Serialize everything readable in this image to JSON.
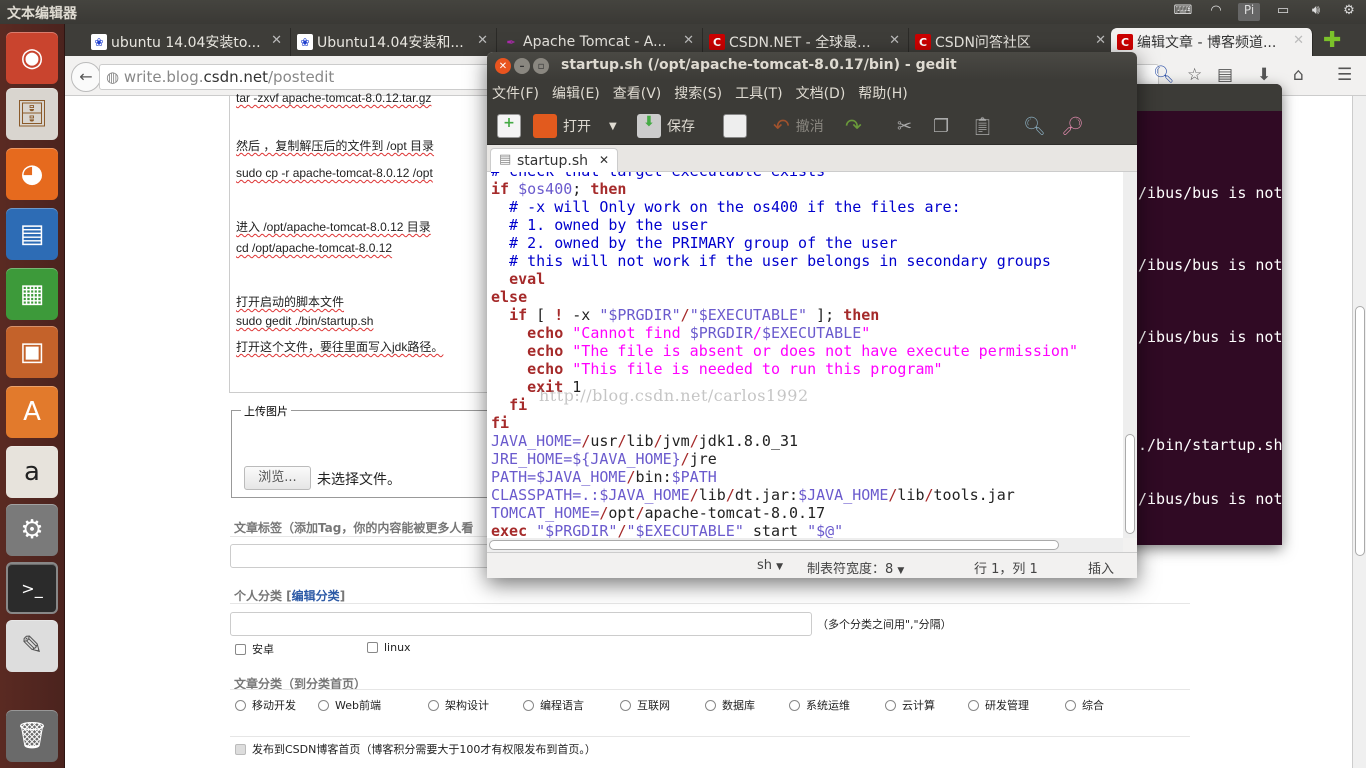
{
  "top_panel": {
    "title": "文本编辑器",
    "indicators": [
      "keyboard-icon",
      "wifi-icon",
      "Pi",
      "battery-icon",
      "volume-icon",
      "power-icon"
    ]
  },
  "launcher": {
    "items": [
      "ubuntu-dash",
      "files",
      "firefox",
      "libreoffice-writer",
      "libreoffice-calc",
      "libreoffice-impress",
      "ubuntu-software-center",
      "amazon",
      "system-settings",
      "terminal",
      "text-editor",
      "trash"
    ]
  },
  "browser": {
    "tabs": [
      {
        "label": "ubuntu 14.04安装to...",
        "icon": "paw-icon"
      },
      {
        "label": "Ubuntu14.04安装和...",
        "icon": "paw-icon"
      },
      {
        "label": "Apache Tomcat - A...",
        "icon": "feather-icon"
      },
      {
        "label": "CSDN.NET - 全球最...",
        "icon": "csdn-icon"
      },
      {
        "label": "CSDN问答社区",
        "icon": "csdn-icon"
      },
      {
        "label": "编辑文章 - 博客频道...",
        "icon": "csdn-icon",
        "active": true
      }
    ],
    "url_host_pre": "write.blog.",
    "url_host": "csdn.net",
    "url_path": "/postedit",
    "article_lines": [
      "tar -zxvf apache-tomcat-8.0.12.tar.gz",
      "然后 ，复制解压后的文件到 /opt 目录",
      "sudo cp -r apache-tomcat-8.0.12 /opt",
      "进入 /opt/apache-tomcat-8.0.12 目录",
      "cd /opt/apache-tomcat-8.0.12",
      "打开启动的脚本文件",
      "sudo gedit ./bin/startup.sh",
      "打开这个文件，要往里面写入jdk路径。"
    ],
    "upload": {
      "legend": "上传图片",
      "browse": "浏览...",
      "no_file": "未选择文件。"
    },
    "tags_label": "文章标签（添加Tag，你的内容能被更多人看",
    "personal_category": {
      "label": "个人分类 [",
      "link": "编辑分类",
      "label_end": "]",
      "hint": "（多个分类之间用\",\"分隔）",
      "options": [
        "安卓",
        "linux"
      ]
    },
    "article_category": {
      "label": "文章分类（到分类首页）",
      "options": [
        "移动开发",
        "Web前端",
        "架构设计",
        "编程语言",
        "互联网",
        "数据库",
        "系统运维",
        "云计算",
        "研发管理",
        "综合"
      ]
    },
    "publish_home": "发布到CSDN博客首页（博客积分需要大于100才有权限发布到首页。）"
  },
  "terminal": {
    "lines": [
      "/ibus/bus is not",
      "/ibus/bus is not",
      "/ibus/bus is not",
      "./bin/startup.sh",
      "/ibus/bus is not"
    ]
  },
  "gedit": {
    "title": "startup.sh (/opt/apache-tomcat-8.0.17/bin) - gedit",
    "menu": [
      "文件(F)",
      "编辑(E)",
      "查看(V)",
      "搜索(S)",
      "工具(T)",
      "文档(D)",
      "帮助(H)"
    ],
    "toolbar": {
      "open": "打开",
      "save": "保存",
      "undo": "撤消"
    },
    "tab": "startup.sh",
    "watermark": "http://blog.csdn.net/carlos1992",
    "code": [
      [
        [
          "# check that target executable exists",
          "cm"
        ]
      ],
      [
        [
          "if",
          "kw"
        ],
        [
          " ",
          "pl"
        ],
        [
          "$os400",
          "vr"
        ],
        [
          "; ",
          "pl"
        ],
        [
          "then",
          "kw"
        ]
      ],
      [
        [
          "  # -x will Only work on the os400 if the files are:",
          "cm"
        ]
      ],
      [
        [
          "  # 1. owned by the user",
          "cm"
        ]
      ],
      [
        [
          "  # 2. owned by the PRIMARY group of the user",
          "cm"
        ]
      ],
      [
        [
          "  # this will not work if the user belongs in secondary groups",
          "cm"
        ]
      ],
      [
        [
          "  ",
          "pl"
        ],
        [
          "eval",
          "kw"
        ]
      ],
      [
        [
          "else",
          "kw"
        ]
      ],
      [
        [
          "  ",
          "pl"
        ],
        [
          "if",
          "kw"
        ],
        [
          " [ ",
          "pl"
        ],
        [
          "!",
          "kw"
        ],
        [
          " -x ",
          "pl"
        ],
        [
          "\"$PRGDIR\"",
          "sq"
        ],
        [
          "/",
          "op"
        ],
        [
          "\"$EXECUTABLE\"",
          "sq"
        ],
        [
          " ]; ",
          "pl"
        ],
        [
          "then",
          "kw"
        ]
      ],
      [
        [
          "    ",
          "pl"
        ],
        [
          "echo",
          "kw"
        ],
        [
          " ",
          "pl"
        ],
        [
          "\"Cannot find ",
          "st"
        ],
        [
          "$PRGDIR",
          "vr"
        ],
        [
          "/",
          "st"
        ],
        [
          "$EXECUTABLE",
          "vr"
        ],
        [
          "\"",
          "st"
        ]
      ],
      [
        [
          "    ",
          "pl"
        ],
        [
          "echo",
          "kw"
        ],
        [
          " ",
          "pl"
        ],
        [
          "\"The file is absent or does not have execute permission\"",
          "st"
        ]
      ],
      [
        [
          "    ",
          "pl"
        ],
        [
          "echo",
          "kw"
        ],
        [
          " ",
          "pl"
        ],
        [
          "\"This file is needed to run this program\"",
          "st"
        ]
      ],
      [
        [
          "    ",
          "pl"
        ],
        [
          "exit",
          "kw"
        ],
        [
          " 1",
          "pl"
        ]
      ],
      [
        [
          "  ",
          "pl"
        ],
        [
          "fi",
          "kw"
        ]
      ],
      [
        [
          "fi",
          "kw"
        ]
      ],
      [
        [
          "JAVA_HOME=",
          "vr"
        ],
        [
          "/",
          "op"
        ],
        [
          "usr",
          "pl"
        ],
        [
          "/",
          "op"
        ],
        [
          "lib",
          "pl"
        ],
        [
          "/",
          "op"
        ],
        [
          "jvm",
          "pl"
        ],
        [
          "/",
          "op"
        ],
        [
          "jdk1.8.0_31",
          "pl"
        ]
      ],
      [
        [
          "JRE_HOME=${JAVA_HOME}",
          "vr"
        ],
        [
          "/",
          "op"
        ],
        [
          "jre",
          "pl"
        ]
      ],
      [
        [
          "PATH=$JAVA_HOME",
          "vr"
        ],
        [
          "/",
          "op"
        ],
        [
          "bin:",
          "pl"
        ],
        [
          "$PATH",
          "vr"
        ]
      ],
      [
        [
          "CLASSPATH=.:$JAVA_HOME",
          "vr"
        ],
        [
          "/",
          "op"
        ],
        [
          "lib",
          "pl"
        ],
        [
          "/",
          "op"
        ],
        [
          "dt.jar:",
          "pl"
        ],
        [
          "$JAVA_HOME",
          "vr"
        ],
        [
          "/",
          "op"
        ],
        [
          "lib",
          "pl"
        ],
        [
          "/",
          "op"
        ],
        [
          "tools.jar",
          "pl"
        ]
      ],
      [
        [
          "TOMCAT_HOME=",
          "vr"
        ],
        [
          "/",
          "op"
        ],
        [
          "opt",
          "pl"
        ],
        [
          "/",
          "op"
        ],
        [
          "apache-tomcat-8.0.17",
          "pl"
        ]
      ],
      [
        [
          "exec",
          "kw"
        ],
        [
          " ",
          "pl"
        ],
        [
          "\"$PRGDIR\"",
          "sq"
        ],
        [
          "/",
          "op"
        ],
        [
          "\"$EXECUTABLE\"",
          "sq"
        ],
        [
          " start ",
          "pl"
        ],
        [
          "\"$@\"",
          "sq"
        ]
      ]
    ],
    "status": {
      "language": "sh",
      "tab_width": "制表符宽度：8",
      "position": "行 1，列 1",
      "mode": "插入"
    }
  }
}
